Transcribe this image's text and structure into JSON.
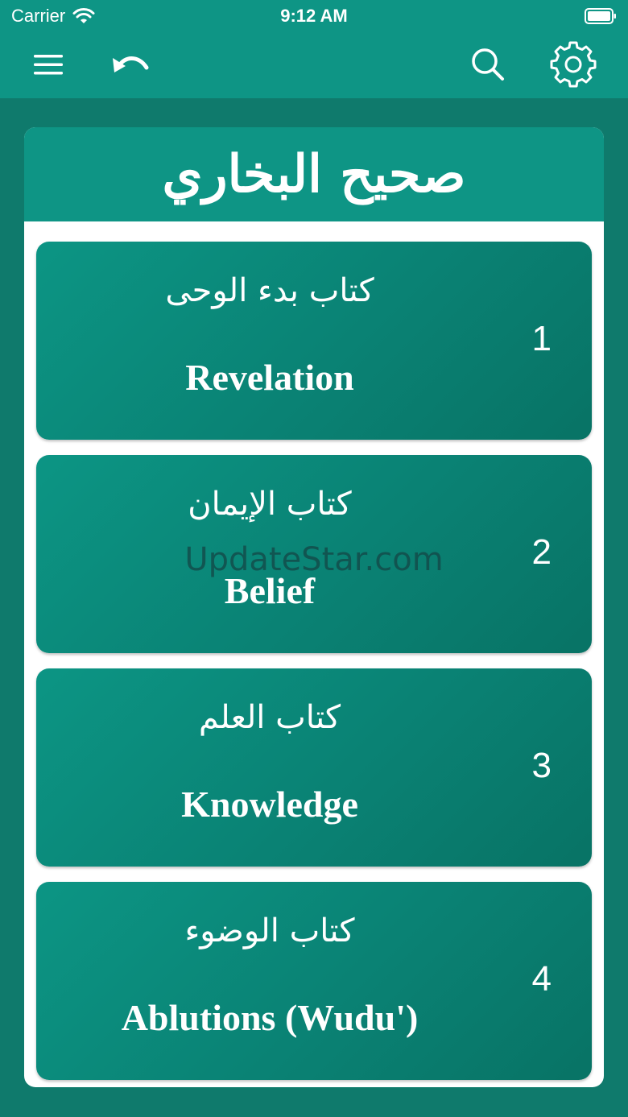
{
  "status_bar": {
    "carrier": "Carrier",
    "time": "9:12 AM",
    "wifi_icon": "wifi-icon",
    "battery_icon": "battery-icon"
  },
  "nav": {
    "menu_icon": "hamburger-menu-icon",
    "back_icon": "undo-arrow-icon",
    "search_icon": "search-icon",
    "settings_icon": "gear-icon"
  },
  "book": {
    "title": "صحيح البخاري"
  },
  "chapters": [
    {
      "arabic": "كتاب بدء الوحى",
      "english": "Revelation",
      "number": "1"
    },
    {
      "arabic": "كتاب الإيمان",
      "english": "Belief",
      "number": "2"
    },
    {
      "arabic": "كتاب العلم",
      "english": "Knowledge",
      "number": "3"
    },
    {
      "arabic": "كتاب الوضوء",
      "english": "Ablutions (Wudu')",
      "number": "4"
    }
  ],
  "watermark": "UpdateStar.com",
  "colors": {
    "primary": "#0e9585",
    "background": "#0f7a6c",
    "card_gradient_dark": "#087365",
    "text_on_primary": "#ffffff"
  }
}
